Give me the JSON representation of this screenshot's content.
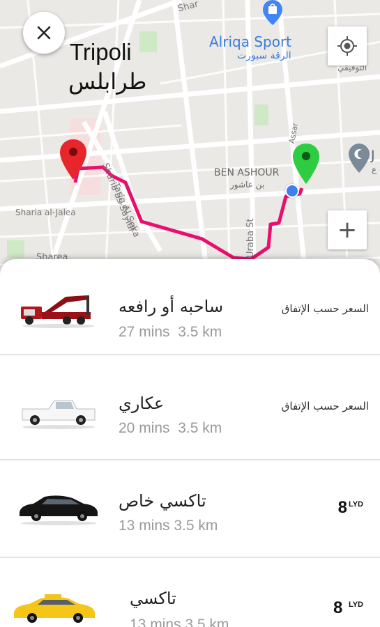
{
  "map": {
    "city_en": "Tripoli",
    "city_ar": "طرابلس",
    "poi_name_en": "Alriqa Sport",
    "poi_name_ar": "الرقة سبورت",
    "district_en": "BEN ASHOUR",
    "district_ar": "بن عاشور",
    "streets": {
      "seka": "Tariq Al Seka",
      "sayidi": "Sharia as-Sayidi",
      "jalea": "Sharia al-Jalea",
      "sharea": "Sharea",
      "uraba": "Uraba St",
      "shar_top": "Shar",
      "assar": "Assar",
      "tawfiq": "التوفيقي",
      "j_label": "J",
      "j_label2": "ع"
    },
    "colors": {
      "route": "#e8106d",
      "pickup_pin": "#2ecc40",
      "dest_pin": "#e8252a",
      "poi_blue": "#4285f4"
    }
  },
  "controls": {
    "close_icon": "close-icon",
    "locate_icon": "my-location-icon",
    "zoom_label": "+"
  },
  "services": [
    {
      "name": "ساحبه أو رافعه",
      "meta": "27 mins  3.5 km",
      "price_text": "السعر حسب الإتفاق",
      "icon": "tow-truck-icon"
    },
    {
      "name": "عكاري",
      "meta": "20 mins  3.5 km",
      "price_text": "السعر حسب الإتفاق",
      "icon": "pickup-truck-icon"
    },
    {
      "name": "تاكسي خاص",
      "meta": "13 mins 3.5 km",
      "price": "8",
      "currency": "LYD",
      "icon": "black-sedan-icon"
    },
    {
      "name": "تاكسي",
      "meta": "13 mins 3.5 km",
      "price": "8",
      "currency": "LYD",
      "icon": "yellow-taxi-icon"
    }
  ]
}
